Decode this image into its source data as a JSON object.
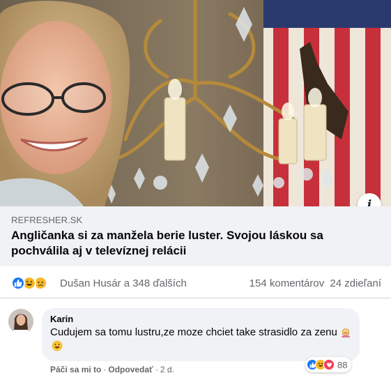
{
  "post": {
    "image_alt": "Woman smiling next to a crystal chandelier",
    "info_icon": "info-icon",
    "link": {
      "domain": "REFRESHER.SK",
      "headline": "Angličanka si za manžela berie luster. Svojou láskou sa pochválila aj v televíznej relácii"
    },
    "stats": {
      "reaction_icons": [
        "like",
        "haha",
        "sad"
      ],
      "reactors": "Dušan Husár a 348 ďalších",
      "comments": "154 komentárov",
      "shares": "24 zdieľaní"
    }
  },
  "comment": {
    "author": "Karin",
    "text": "Cudujem sa tomu lustru,ze moze chciet take strasidlo za zenu",
    "reaction_icons": [
      "like",
      "haha",
      "love"
    ],
    "reaction_count": "88",
    "actions": {
      "like": "Páči sa mi to",
      "reply": "Odpovedať",
      "time": "2 d."
    }
  },
  "colors": {
    "facebook_blue": "#1877f2",
    "secondary_text": "#65676b",
    "bubble_bg": "#f0f2f5",
    "haha_yellow": "#f7b928",
    "love_red": "#f33e58"
  }
}
